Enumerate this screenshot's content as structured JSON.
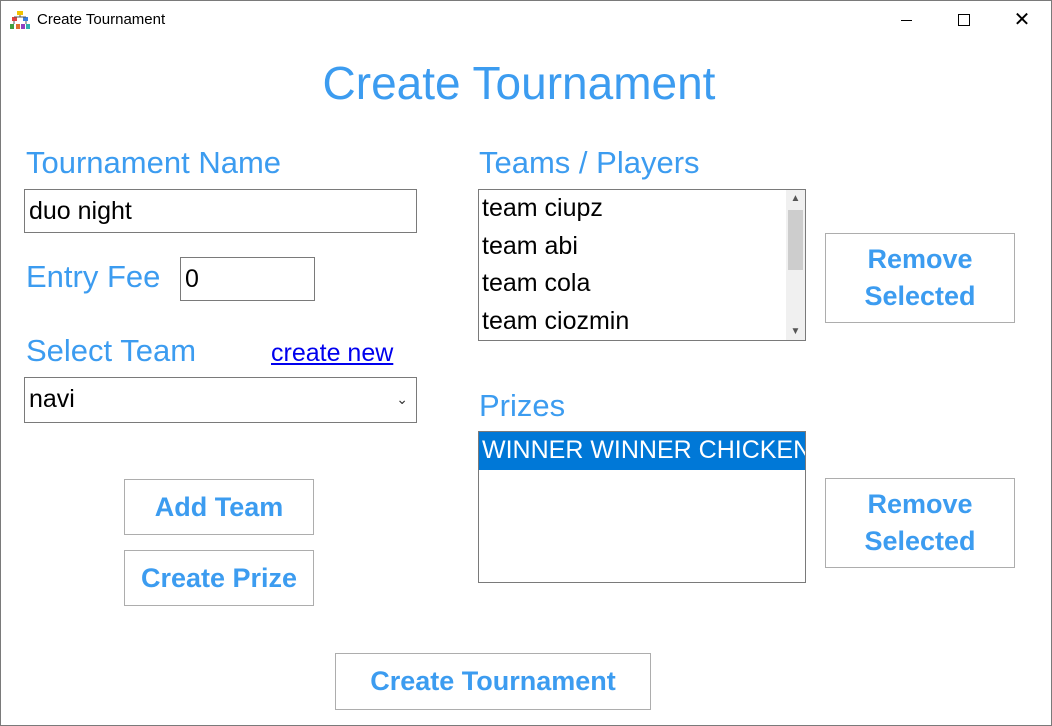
{
  "window": {
    "title": "Create Tournament"
  },
  "form": {
    "heading": "Create Tournament",
    "tournament_name_label": "Tournament Name",
    "tournament_name_value": "duo night",
    "entry_fee_label": "Entry Fee",
    "entry_fee_value": "0",
    "select_team_label": "Select Team",
    "create_new_link": "create new",
    "selected_team": "navi",
    "add_team_button": "Add Team",
    "create_prize_button": "Create Prize",
    "create_tournament_button": "Create Tournament"
  },
  "teams": {
    "label": "Teams / Players",
    "items": [
      "team ciupz",
      "team abi",
      "team cola",
      "team ciozmin"
    ],
    "remove_button": [
      "Remove",
      "Selected"
    ]
  },
  "prizes": {
    "label": "Prizes",
    "items": [
      "WINNER WINNER CHICKEN DINNER"
    ],
    "remove_button": [
      "Remove",
      "Selected"
    ]
  },
  "colors": {
    "accent": "#3c9cf0",
    "selection": "#0078d7",
    "link": "#0000ee"
  },
  "icons": {
    "app": "tournament-bracket-icon",
    "minimize": "minimize-icon",
    "maximize": "maximize-icon",
    "close": "close-icon",
    "dropdown": "chevron-down-icon"
  }
}
